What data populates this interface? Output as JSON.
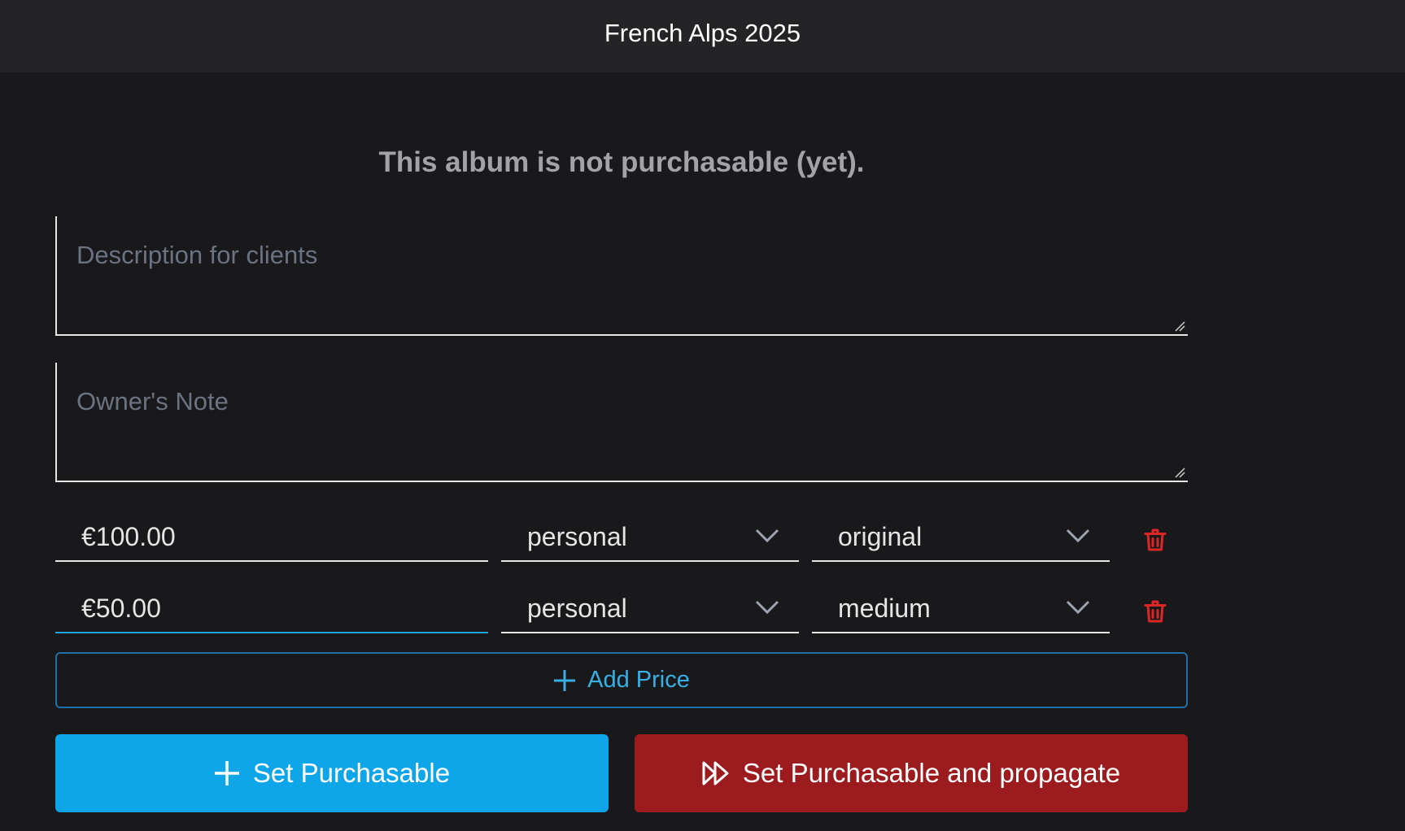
{
  "header": {
    "title": "French Alps 2025"
  },
  "notice": "This album is not purchasable (yet).",
  "description": {
    "placeholder": "Description for clients",
    "value": ""
  },
  "owner_note": {
    "placeholder": "Owner's Note",
    "value": ""
  },
  "prices": [
    {
      "amount": "€100.00",
      "license": "personal",
      "size": "original"
    },
    {
      "amount": "€50.00",
      "license": "personal",
      "size": "medium"
    }
  ],
  "add_price_label": "Add Price",
  "set_purchasable_label": "Set Purchasable",
  "set_purchasable_propagate_label": "Set Purchasable and propagate",
  "colors": {
    "background": "#19191c",
    "header": "#242427",
    "accent": "#0ea5e9",
    "danger": "#9b1b1e",
    "trash": "#dc2626",
    "active_underline": "#22a5de"
  },
  "icons": {
    "add": "plus-icon",
    "delete": "trash-icon",
    "dropdown": "chevron-down-icon",
    "propagate": "fast-forward-icon"
  }
}
